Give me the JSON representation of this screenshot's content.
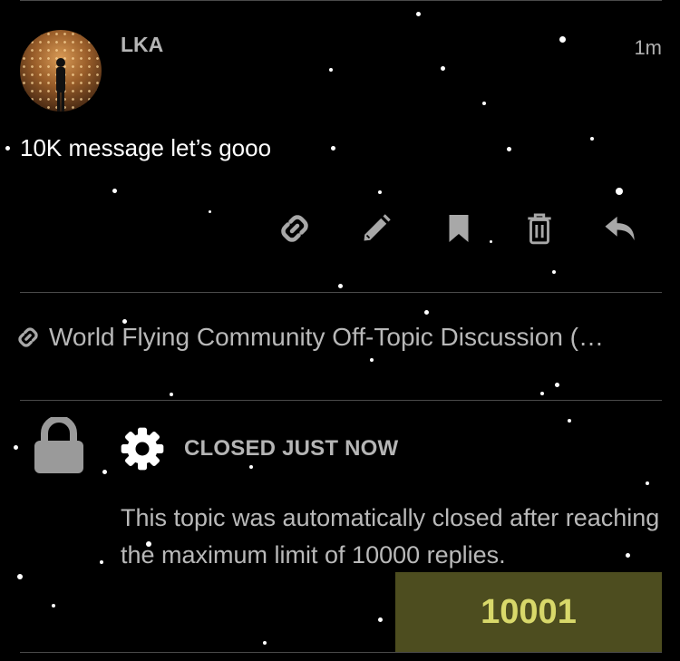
{
  "post": {
    "username": "LKA",
    "timestamp": "1m",
    "message": "10K message let’s gooo",
    "actions": [
      "link-icon",
      "pencil-icon",
      "bookmark-icon",
      "trash-icon",
      "reply-icon"
    ]
  },
  "linked_topic": {
    "title": "World Flying Community Off-Topic Discussion (…"
  },
  "closed_notice": {
    "title": "CLOSED JUST NOW",
    "description": "This topic was automatically closed after reaching the maximum limit of 10000 replies."
  },
  "post_counter": {
    "value": "10001",
    "background_color": "#4d4d1f",
    "text_color": "#d8d86a"
  }
}
